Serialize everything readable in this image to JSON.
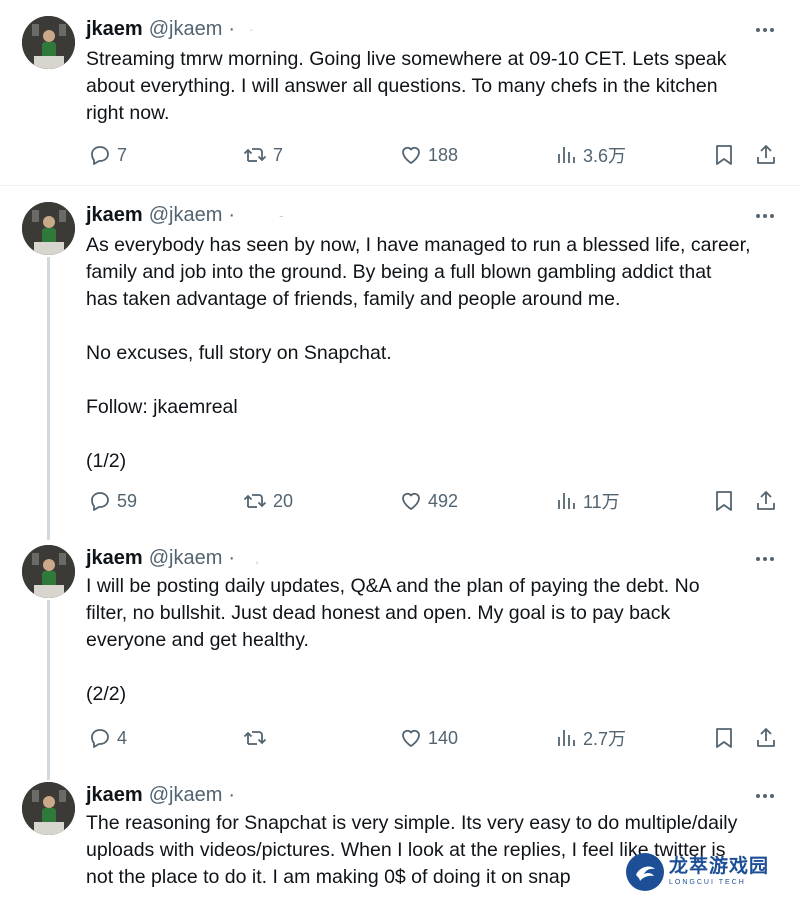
{
  "tweets": [
    {
      "name": "jkaem",
      "handle": "@jkaem",
      "dot": "·",
      "time": "·",
      "body": [
        "Streaming tmrw morning. Going live somewhere at 09-10 CET. Lets speak",
        "about everything. I will answer all questions. To many chefs in the kitchen",
        "right now."
      ],
      "replies": "7",
      "retweets": "7",
      "likes": "188",
      "views": "3.6万"
    },
    {
      "name": "jkaem",
      "handle": "@jkaem",
      "dot": "·",
      "time": "-",
      "body": [
        "As everybody has seen by now, I have managed to run a blessed life, career,",
        "family and job into the ground. By being a full blown gambling addict that",
        "has taken advantage of friends, family and people around me.",
        "",
        "No excuses, full story on Snapchat.",
        "",
        "Follow: jkaemreal",
        "",
        "(1/2)"
      ],
      "replies": "59",
      "retweets": "20",
      "likes": "492",
      "views": "11万"
    },
    {
      "name": "jkaem",
      "handle": "@jkaem",
      "dot": "·",
      "time": ",",
      "body": [
        "I will be posting daily updates, Q&A and the plan of paying the debt. No",
        "filter, no bullshit. Just dead honest and open. My goal is to pay back",
        "everyone and get healthy.",
        "",
        "(2/2)"
      ],
      "replies": "4",
      "retweets": "",
      "likes": "140",
      "views": "2.7万"
    },
    {
      "name": "jkaem",
      "handle": "@jkaem",
      "dot": "·",
      "time": "",
      "body": [
        "The reasoning for Snapchat is very simple. Its very easy to do multiple/daily",
        "uploads with videos/pictures. When I look at the replies, I feel like twitter is",
        "not the place to do it. I am making 0$ of doing it on snap"
      ]
    }
  ],
  "icons": {
    "reply": "reply-icon",
    "retweet": "retweet-icon",
    "like": "heart-icon",
    "views": "views-icon",
    "bookmark": "bookmark-icon",
    "share": "share-icon",
    "more": "more-icon"
  },
  "colors": {
    "text": "#0f1419",
    "muted": "#536471",
    "divider": "#eff3f4",
    "thread_line": "#cfd9de",
    "watermark": "#1c4f96"
  },
  "watermark": {
    "cn": "龙萃游戏园",
    "en": "LONGCUI TECH"
  }
}
